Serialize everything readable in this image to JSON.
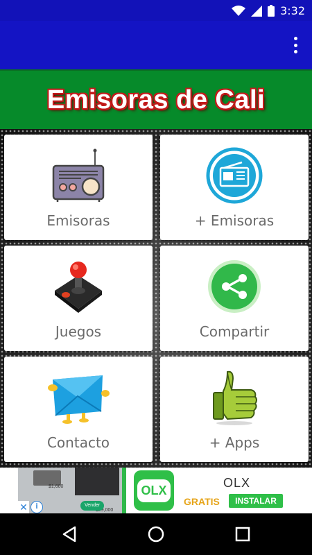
{
  "status_bar": {
    "time": "3:32"
  },
  "banner": {
    "title": "Emisoras de Cali"
  },
  "tiles": [
    {
      "label": "Emisoras",
      "icon": "radio-icon"
    },
    {
      "label": "+ Emisoras",
      "icon": "radio-circle-icon"
    },
    {
      "label": "Juegos",
      "icon": "joystick-icon"
    },
    {
      "label": "Compartir",
      "icon": "share-icon"
    },
    {
      "label": "Contacto",
      "icon": "mail-icon"
    },
    {
      "label": "+ Apps",
      "icon": "thumbs-up-icon"
    }
  ],
  "ad": {
    "title": "OLX",
    "logo_text": "OLX",
    "subtitle": "GRATIS",
    "button": "INSTALAR",
    "preview_chip": "Vender",
    "preview_price_1": "$1,600",
    "preview_price_2": "$29,000",
    "close_symbol": "✕",
    "info_symbol": "i"
  },
  "colors": {
    "app_bar": "#1414c4",
    "banner": "#068a2a",
    "banner_text_outline": "#c21a1a",
    "olx_green": "#2fbf48",
    "gratis": "#e6a418"
  }
}
